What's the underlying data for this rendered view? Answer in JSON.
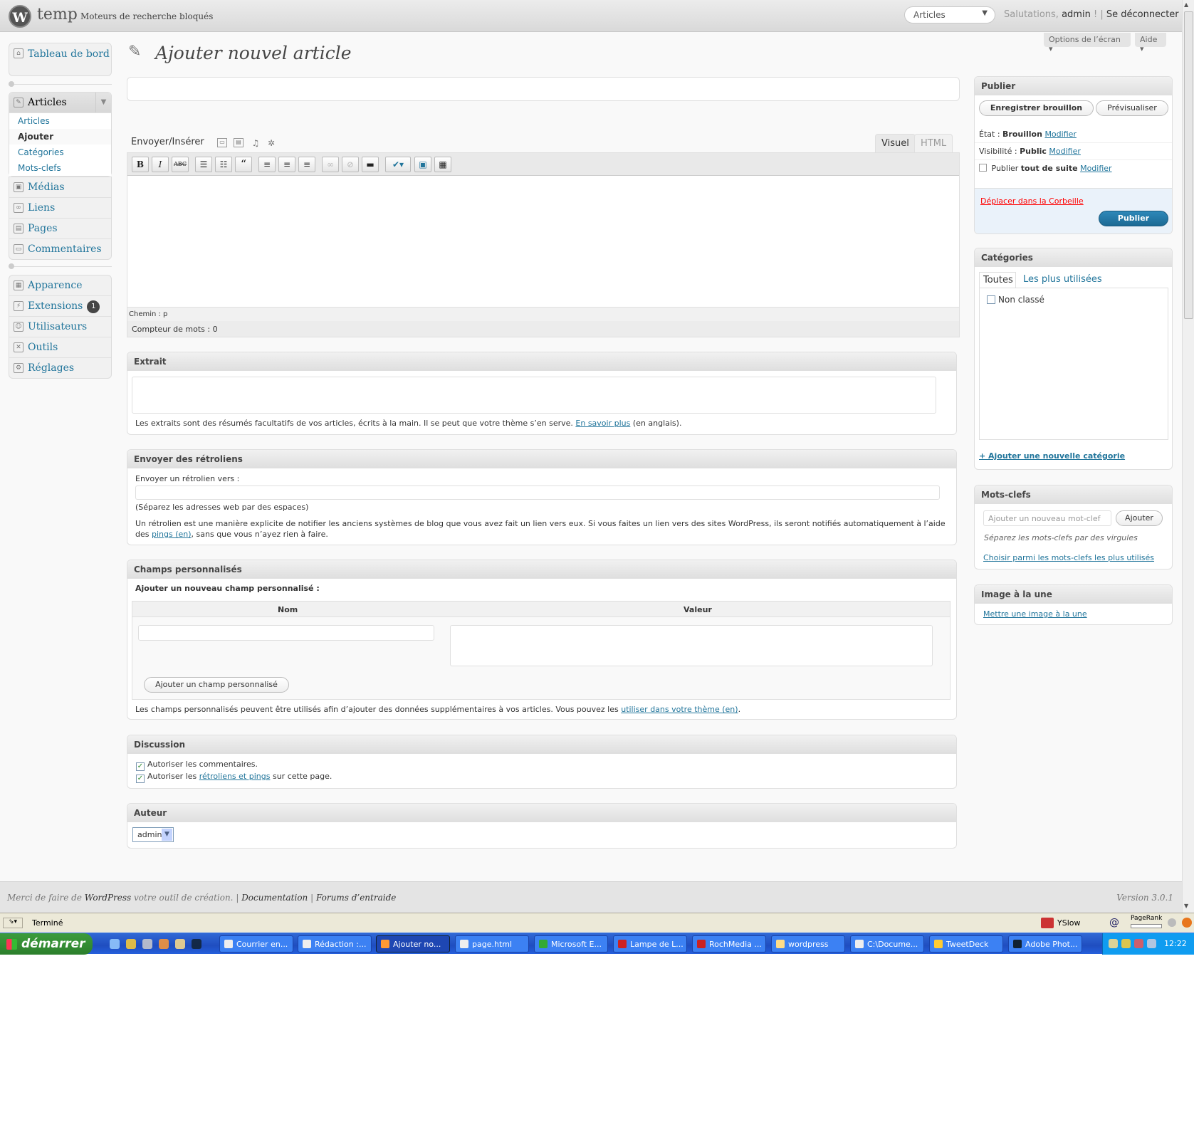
{
  "header": {
    "site_name": "temp",
    "visit_site": "Moteurs de recherche bloqués",
    "favorites_select": "Articles",
    "greeting": "Salutations,",
    "username": "admin",
    "greeting_sep": "! |",
    "logout": "Se déconnecter",
    "screen_options": "Options de l’écran",
    "help": "Aide"
  },
  "sidebar": {
    "dashboard": "Tableau de bord",
    "articles": "Articles",
    "articles_sub": [
      "Articles",
      "Ajouter",
      "Catégories",
      "Mots-clefs"
    ],
    "media": "Médias",
    "links": "Liens",
    "pages": "Pages",
    "comments": "Commentaires",
    "appearance": "Apparence",
    "plugins": "Extensions",
    "plugins_count": "1",
    "users": "Utilisateurs",
    "tools": "Outils",
    "settings": "Réglages"
  },
  "main": {
    "title": "Ajouter nouvel article",
    "upload_label": "Envoyer/Insérer",
    "tab_visual": "Visuel",
    "tab_html": "HTML",
    "path": "Chemin : p",
    "word_count": "Compteur de mots : 0"
  },
  "excerpt": {
    "title": "Extrait",
    "help": "Les extraits sont des résumés facultatifs de vos articles, écrits à la main. Il se peut que votre thème s’en serve.",
    "learn_more": "En savoir plus",
    "learn_more_suffix": "(en anglais)."
  },
  "trackbacks": {
    "title": "Envoyer des rétroliens",
    "label": "Envoyer un rétrolien vers :",
    "hint": "(Séparez les adresses web par des espaces)",
    "help_part1": "Un rétrolien est une manière explicite de notifier les anciens systèmes de blog que vous avez fait un lien vers eux. Si vous faites un lien vers des sites WordPress, ils seront notifiés automatiquement à l’aide des",
    "help_link": "pings (en)",
    "help_part2": ", sans que vous n’ayez rien à faire."
  },
  "custom_fields": {
    "title": "Champs personnalisés",
    "add_new": "Ajouter un nouveau champ personnalisé :",
    "col_name": "Nom",
    "col_value": "Valeur",
    "add_button": "Ajouter un champ personnalisé",
    "help_part1": "Les champs personnalisés peuvent être utilisés afin d’ajouter des données supplémentaires à vos articles. Vous pouvez les",
    "help_link": "utiliser dans votre thème (en)",
    "help_part2": "."
  },
  "discussion": {
    "title": "Discussion",
    "allow_comments": "Autoriser les commentaires.",
    "allow_pings_prefix": "Autoriser les",
    "allow_pings_link": "rétroliens et pings",
    "allow_pings_suffix": "sur cette page."
  },
  "author": {
    "title": "Auteur",
    "value": "admin"
  },
  "publish": {
    "title": "Publier",
    "save_draft": "Enregistrer brouillon",
    "preview": "Prévisualiser",
    "status_label": "État :",
    "status_value": "Brouillon",
    "visibility_label": "Visibilité :",
    "visibility_value": "Public",
    "publish_label": "Publier",
    "publish_value": "tout de suite",
    "edit": "Modifier",
    "trash": "Déplacer dans la Corbeille",
    "publish_button": "Publier"
  },
  "categories": {
    "title": "Catégories",
    "tab_all": "Toutes",
    "tab_popular": "Les plus utilisées",
    "items": [
      "Non classé"
    ],
    "add_new": "+ Ajouter une nouvelle catégorie"
  },
  "tags": {
    "title": "Mots-clefs",
    "placeholder": "Ajouter un nouveau mot-clef",
    "add_button": "Ajouter",
    "hint": "Séparez les mots-clefs par des virgules",
    "choose": "Choisir parmi les mots-clefs les plus utilisés"
  },
  "featured_image": {
    "title": "Image à la une",
    "set": "Mettre une image à la une"
  },
  "footer": {
    "thanks_prefix": "Merci de faire de",
    "wordpress": "WordPress",
    "thanks_suffix": "votre outil de création. |",
    "documentation": "Documentation",
    "sep": "|",
    "forums": "Forums d’entraide",
    "version": "Version 3.0.1"
  },
  "browser_status": {
    "text": "Terminé",
    "yslow": "YSlow",
    "pagerank": "PageRank"
  },
  "taskbar": {
    "start": "démarrer",
    "items": [
      "Courrier en...",
      "Rédaction :...",
      "Ajouter no...",
      "page.html",
      "Microsoft E...",
      "Lampe de L...",
      "RochMedia ...",
      "wordpress",
      "C:\\Docume...",
      "TweetDeck",
      "Adobe Phot..."
    ],
    "clock": "12:22"
  },
  "colors": {
    "link": "#21759b",
    "primary_button": "#21759b",
    "trash": "#ff0000",
    "taskbar": "#245edb",
    "start": "#3c9c3c"
  }
}
